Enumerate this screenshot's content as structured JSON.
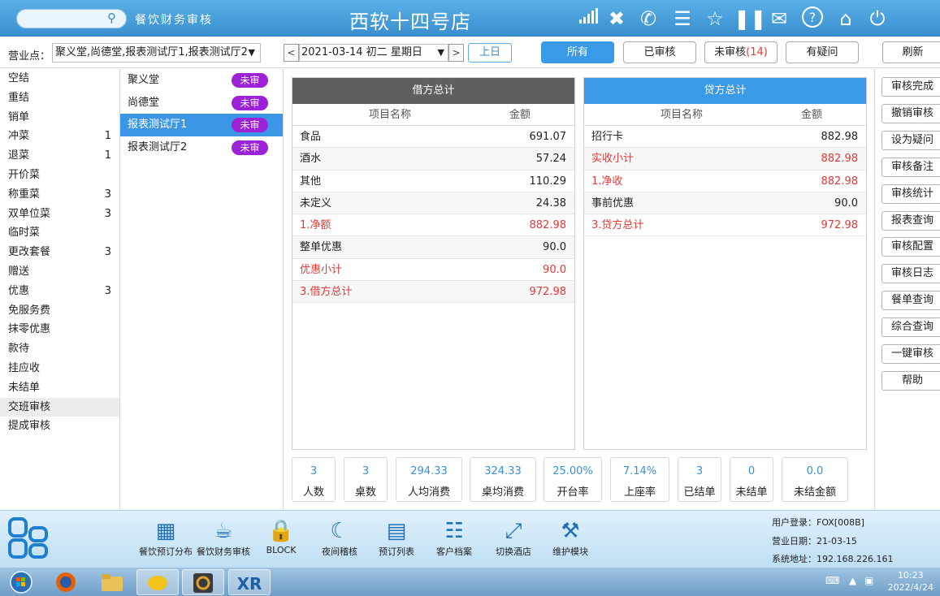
{
  "header": {
    "app_title": "餐饮财务审核",
    "store_title": "西软十四号店"
  },
  "toolbar": {
    "venue_label": "营业点：",
    "venue_value": "聚义堂,尚德堂,报表测试厅1,报表测试厅2",
    "date_value": "2021-03-14  初二  星期日",
    "prev_label": "上日",
    "filters": [
      {
        "label": "所有",
        "count": ""
      },
      {
        "label": "已审核",
        "count": ""
      },
      {
        "label": "未审核",
        "count": "(14)"
      },
      {
        "label": "有疑问",
        "count": ""
      }
    ],
    "refresh_label": "刷新"
  },
  "categories": [
    {
      "label": "空结",
      "count": ""
    },
    {
      "label": "重结",
      "count": ""
    },
    {
      "label": "销单",
      "count": ""
    },
    {
      "label": "冲菜",
      "count": "1"
    },
    {
      "label": "退菜",
      "count": "1"
    },
    {
      "label": "开价菜",
      "count": ""
    },
    {
      "label": "称重菜",
      "count": "3"
    },
    {
      "label": "双单位菜",
      "count": "3"
    },
    {
      "label": "临时菜",
      "count": ""
    },
    {
      "label": "更改套餐",
      "count": "3"
    },
    {
      "label": "赠送",
      "count": ""
    },
    {
      "label": "优惠",
      "count": "3"
    },
    {
      "label": "免服务费",
      "count": ""
    },
    {
      "label": "抹零优惠",
      "count": ""
    },
    {
      "label": "款待",
      "count": ""
    },
    {
      "label": "挂应收",
      "count": ""
    },
    {
      "label": "未结单",
      "count": ""
    },
    {
      "label": "交班审核",
      "count": ""
    },
    {
      "label": "提成审核",
      "count": ""
    }
  ],
  "halls": [
    {
      "name": "聚义堂",
      "badge": "未审"
    },
    {
      "name": "尚德堂",
      "badge": "未审"
    },
    {
      "name": "报表测试厅1",
      "badge": "未审"
    },
    {
      "name": "报表测试厅2",
      "badge": "未审"
    }
  ],
  "debit": {
    "title": "借方总计",
    "col_name": "项目名称",
    "col_amount": "金额",
    "rows": [
      {
        "name": "食品",
        "amount": "691.07",
        "red": false
      },
      {
        "name": "酒水",
        "amount": "57.24",
        "red": false
      },
      {
        "name": "其他",
        "amount": "110.29",
        "red": false
      },
      {
        "name": "未定义",
        "amount": "24.38",
        "red": false
      },
      {
        "name": "1.净额",
        "amount": "882.98",
        "red": true
      },
      {
        "name": "整单优惠",
        "amount": "90.0",
        "red": false
      },
      {
        "name": "优惠小计",
        "amount": "90.0",
        "red": true
      },
      {
        "name": "3.借方总计",
        "amount": "972.98",
        "red": true
      }
    ]
  },
  "credit": {
    "title": "贷方总计",
    "col_name": "项目名称",
    "col_amount": "金额",
    "rows": [
      {
        "name": "招行卡",
        "amount": "882.98",
        "red": false
      },
      {
        "name": "实收小计",
        "amount": "882.98",
        "red": true
      },
      {
        "name": "1.净收",
        "amount": "882.98",
        "red": true
      },
      {
        "name": "事前优惠",
        "amount": "90.0",
        "red": false
      },
      {
        "name": "3.贷方总计",
        "amount": "972.98",
        "red": true
      }
    ]
  },
  "stats": [
    {
      "value": "3",
      "label": "人数"
    },
    {
      "value": "3",
      "label": "桌数"
    },
    {
      "value": "294.33",
      "label": "人均消费"
    },
    {
      "value": "324.33",
      "label": "桌均消费"
    },
    {
      "value": "25.00%",
      "label": "开台率"
    },
    {
      "value": "7.14%",
      "label": "上座率"
    },
    {
      "value": "3",
      "label": "已结单"
    },
    {
      "value": "0",
      "label": "未结单"
    },
    {
      "value": "0.0",
      "label": "未结金额"
    }
  ],
  "actions": [
    "审核完成",
    "撤销审核",
    "设为疑问",
    "审核备注",
    "审核统计",
    "报表查询",
    "审核配置",
    "审核日志",
    "餐单查询",
    "综合查询",
    "一键审核",
    "帮助"
  ],
  "modules": [
    {
      "label": "餐饮预订分布",
      "icon": "grid-icon"
    },
    {
      "label": "餐饮财务审核",
      "icon": "coffee-icon"
    },
    {
      "label": "BLOCK",
      "icon": "lock-icon"
    },
    {
      "label": "夜间稽核",
      "icon": "moon-icon"
    },
    {
      "label": "预订列表",
      "icon": "list-icon"
    },
    {
      "label": "客户档案",
      "icon": "profile-icon"
    },
    {
      "label": "切换酒店",
      "icon": "switch-icon"
    },
    {
      "label": "维护模块",
      "icon": "tools-icon"
    }
  ],
  "system_info": {
    "user": "用户登录：FOX[008B]",
    "biz_date": "营业日期：21-03-15",
    "address": "系统地址：192.168.226.161"
  },
  "taskbar": {
    "time": "10:23",
    "date": "2022/4/24"
  },
  "colors": {
    "accent": "#3b9ae8",
    "badge": "#9b22d6",
    "alert": "#e53935",
    "debit_header": "#5f5f5f"
  }
}
